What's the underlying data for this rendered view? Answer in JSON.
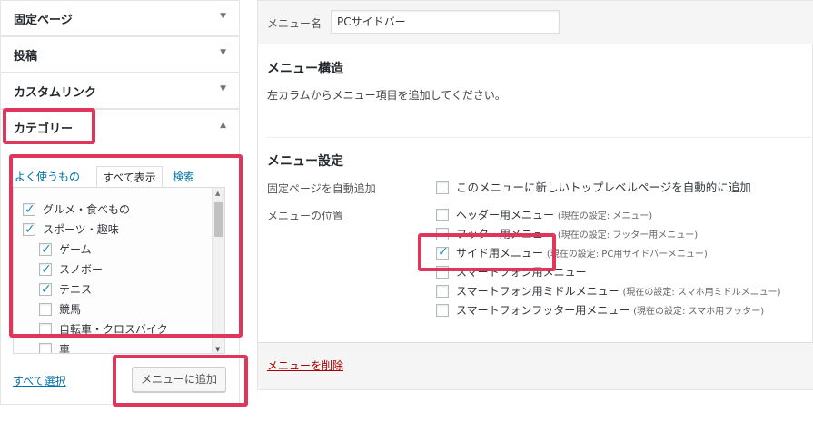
{
  "accordion": {
    "items": [
      {
        "label": "固定ページ"
      },
      {
        "label": "投稿"
      },
      {
        "label": "カスタムリンク"
      }
    ],
    "open": {
      "label": "カテゴリー"
    },
    "tabs": {
      "recent": "よく使うもの",
      "all": "すべて表示",
      "search": "検索"
    },
    "categories": [
      {
        "name": "グルメ・食べもの",
        "checked": true
      },
      {
        "name": "スポーツ・趣味",
        "checked": true
      },
      {
        "name": "ゲーム",
        "checked": true
      },
      {
        "name": "スノボー",
        "checked": true
      },
      {
        "name": "テニス",
        "checked": true
      },
      {
        "name": "競馬",
        "checked": false
      },
      {
        "name": "自転車・クロスバイク",
        "checked": false
      },
      {
        "name": "車",
        "checked": false
      }
    ],
    "select_all": "すべて選択",
    "add_button": "メニューに追加"
  },
  "menu": {
    "name_label": "メニュー名",
    "name_value": "PCサイドバー",
    "structure_title": "メニュー構造",
    "structure_desc": "左カラムからメニュー項目を追加してください。",
    "settings_title": "メニュー設定",
    "auto_add_label": "固定ページを自動追加",
    "auto_add_option": "このメニューに新しいトップレベルページを自動的に追加",
    "location_label": "メニューの位置",
    "locations": [
      {
        "name": "ヘッダー用メニュー",
        "note": "(現在の設定: メニュー)",
        "checked": false
      },
      {
        "name": "フッター用メニュー",
        "note": "(現在の設定: フッター用メニュー)",
        "checked": false
      },
      {
        "name": "サイド用メニュー",
        "note": "(現在の設定: PC用サイドバーメニュー)",
        "checked": true
      },
      {
        "name": "スマートフォン用メニュー",
        "note": "",
        "checked": false
      },
      {
        "name": "スマートフォン用ミドルメニュー",
        "note": "(現在の設定: スマホ用ミドルメニュー)",
        "checked": false
      },
      {
        "name": "スマートフォンフッター用メニュー",
        "note": "(現在の設定: スマホ用フッター)",
        "checked": false
      }
    ],
    "delete_link": "メニューを削除"
  },
  "colors": {
    "highlight": "#e0365c",
    "link": "#0073aa",
    "delete": "#aa0000",
    "check": "#1e8cbe"
  }
}
